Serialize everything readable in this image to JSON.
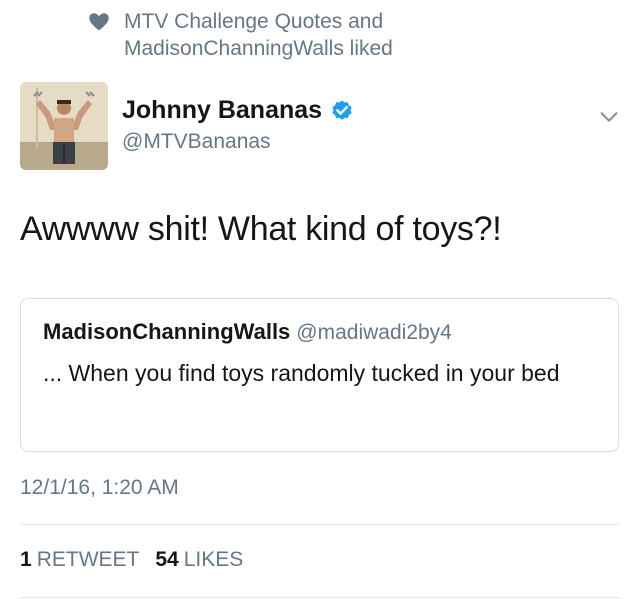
{
  "liked": {
    "text": "MTV Challenge Quotes and MadisonChanningWalls liked",
    "icon": "heart-icon"
  },
  "tweet": {
    "author_name": "Johnny Bananas",
    "author_handle": "@MTVBananas",
    "verified_icon": "verified-badge-icon",
    "text": "Awwww shit! What kind of toys?!",
    "timestamp": "12/1/16, 1:20 AM"
  },
  "quote": {
    "author_name": "MadisonChanningWalls",
    "author_handle": "@madiwadi2by4",
    "text": "... When you find toys randomly tucked in your bed"
  },
  "stats": {
    "retweets_count": "1",
    "retweets_label": "RETWEET",
    "likes_count": "54",
    "likes_label": "LIKES"
  },
  "colors": {
    "text_primary": "#14171a",
    "text_secondary": "#657786",
    "verified_blue": "#1da1f2",
    "border": "#d8dde3"
  }
}
